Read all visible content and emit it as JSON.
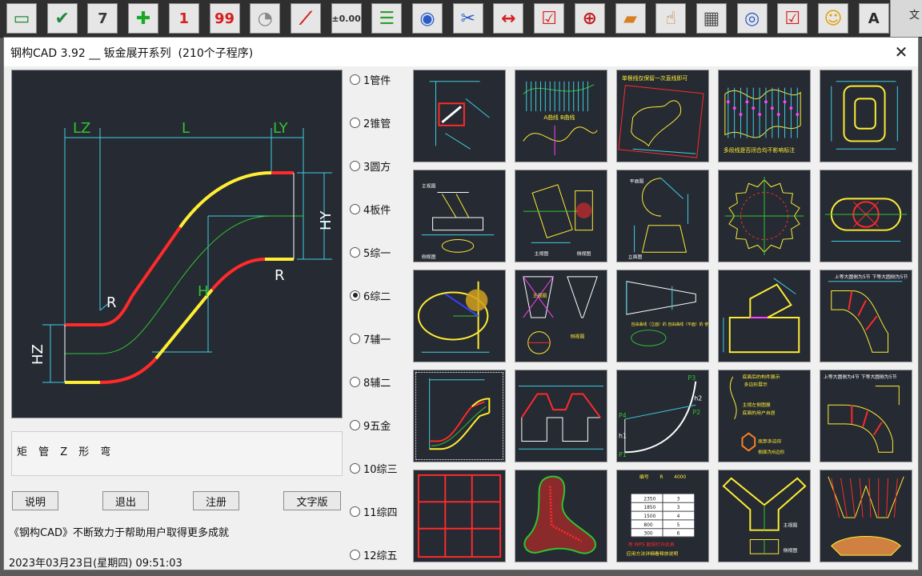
{
  "window": {
    "title": "钢构CAD 3.92 __ 钣金展开系列  (210个子程序)",
    "close_glyph": "✕"
  },
  "toolbar": {
    "buttons": [
      {
        "icon": "window-icon"
      },
      {
        "icon": "checkmark-icon"
      },
      {
        "icon": "calendar-icon",
        "text": "7"
      },
      {
        "icon": "plus-icon"
      },
      {
        "icon": "circled-one-icon",
        "text": "1"
      },
      {
        "icon": "number-99-icon",
        "text": "99"
      },
      {
        "icon": "fan-icon"
      },
      {
        "icon": "red-lines-icon"
      },
      {
        "icon": "decimal-icon",
        "text": "±0.00"
      },
      {
        "icon": "align-lines-icon"
      },
      {
        "icon": "eye-icon"
      },
      {
        "icon": "scissors-icon"
      },
      {
        "icon": "dimension-check-icon"
      },
      {
        "icon": "layers-check-icon"
      },
      {
        "icon": "zoom-in-icon"
      },
      {
        "icon": "paint-bucket-icon"
      },
      {
        "icon": "hand-pointer-icon"
      },
      {
        "icon": "calculator-icon"
      },
      {
        "icon": "globe-record-icon"
      },
      {
        "icon": "checklist-icon"
      },
      {
        "icon": "smiley-icon"
      },
      {
        "icon": "text-style-icon",
        "text": "A"
      }
    ],
    "right_label": "文"
  },
  "categories": [
    {
      "label": "1管件",
      "selected": false
    },
    {
      "label": "2锥管",
      "selected": false
    },
    {
      "label": "3圆方",
      "selected": false
    },
    {
      "label": "4板件",
      "selected": false
    },
    {
      "label": "5综一",
      "selected": false
    },
    {
      "label": "6综二",
      "selected": true
    },
    {
      "label": "7辅一",
      "selected": false
    },
    {
      "label": "8辅二",
      "selected": false
    },
    {
      "label": "9五金",
      "selected": false
    },
    {
      "label": "10综三",
      "selected": false
    },
    {
      "label": "11综四",
      "selected": false
    },
    {
      "label": "12综五",
      "selected": false
    }
  ],
  "preview": {
    "labels": {
      "lz": "LZ",
      "l": "L",
      "ly": "LY",
      "hy": "HY",
      "h": "H",
      "hz": "HZ",
      "r1": "R",
      "r2": "R"
    }
  },
  "description": "矩 管 Z 形 弯",
  "buttons": {
    "explain": "说明",
    "exit": "退出",
    "register": "注册",
    "text_version": "文字版"
  },
  "slogan": "《钢构CAD》不断致力于帮助用户取得更多成就",
  "datetime": "2023年03月23日(星期四)  09:51:03",
  "thumbnails": {
    "selected_index": 15,
    "texts": {
      "t3": "单根线仅保留一次直线即可",
      "t4": "多段线是否闭合均不影响标注",
      "t2": "A曲线 B曲线",
      "t6a": "主视图",
      "t6b": "侧视图",
      "t7a": "主视图",
      "t7b": "侧视图",
      "t8a": "平面图",
      "t8b": "立面图",
      "t12a": "主视图",
      "t12b": "侧视图",
      "t13": "自由曲线（立面）的 自由曲线（平面）的 使用户自己绘图",
      "t15": "上等大圆侧为5节 下等大圆侧为5节",
      "t18a": "P3",
      "t18b": "h2",
      "t18c": "P2",
      "t18d": "P4",
      "t18e": "h1",
      "t18f": "P1",
      "t19a": "底面后的构件展示",
      "t19b": "多边形展示",
      "t19c": "主视左侧图展",
      "t19d": "底面的用户自居",
      "t19e": "底部多边形",
      "t19f": "侧面为6边形",
      "t20": "上等大圆侧为4节 下等大圆侧为5节",
      "t23a": "用 WPS 能保打开此表",
      "t23b": "应用方法详细看释放说明",
      "t23_header": [
        "编号",
        "R",
        "4000"
      ],
      "t23_rows": [
        [
          "2350",
          "3"
        ],
        [
          "1850",
          "3"
        ],
        [
          "1500",
          "4"
        ],
        [
          "800",
          "5"
        ],
        [
          "300",
          "6"
        ]
      ],
      "t24a": "主视图",
      "t24b": "侧视图"
    }
  }
}
